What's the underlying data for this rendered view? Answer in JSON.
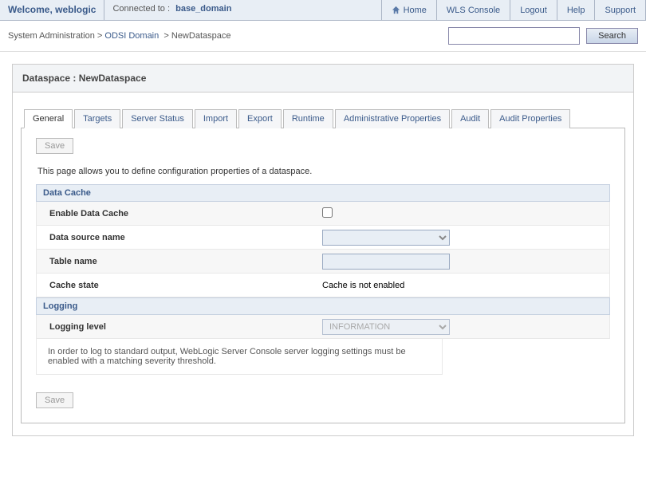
{
  "header": {
    "welcome": "Welcome, weblogic",
    "connected_label": "Connected to :",
    "connected_domain": "base_domain",
    "links": {
      "home": "Home",
      "wls": "WLS Console",
      "logout": "Logout",
      "help": "Help",
      "support": "Support"
    }
  },
  "breadcrumb": {
    "root": "System Administration",
    "sep": ">",
    "odsi": "ODSI Domain",
    "current": "NewDataspace"
  },
  "search": {
    "button": "Search",
    "value": ""
  },
  "panel": {
    "title": "Dataspace : NewDataspace"
  },
  "tabs": {
    "general": "General",
    "targets": "Targets",
    "server_status": "Server Status",
    "import": "Import",
    "export": "Export",
    "runtime": "Runtime",
    "admin_props": "Administrative Properties",
    "audit": "Audit",
    "audit_props": "Audit Properties"
  },
  "form": {
    "save": "Save",
    "description": "This page allows you to define configuration properties of a dataspace.",
    "sections": {
      "data_cache": "Data Cache",
      "logging": "Logging"
    },
    "labels": {
      "enable_data_cache": "Enable Data Cache",
      "data_source_name": "Data source name",
      "table_name": "Table name",
      "cache_state": "Cache state",
      "logging_level": "Logging level"
    },
    "values": {
      "data_source_name": "",
      "table_name": "",
      "cache_state": "Cache is not enabled",
      "logging_level": "INFORMATION"
    },
    "note": "In order to log to standard output, WebLogic Server Console server logging settings must be enabled with a matching severity threshold."
  }
}
